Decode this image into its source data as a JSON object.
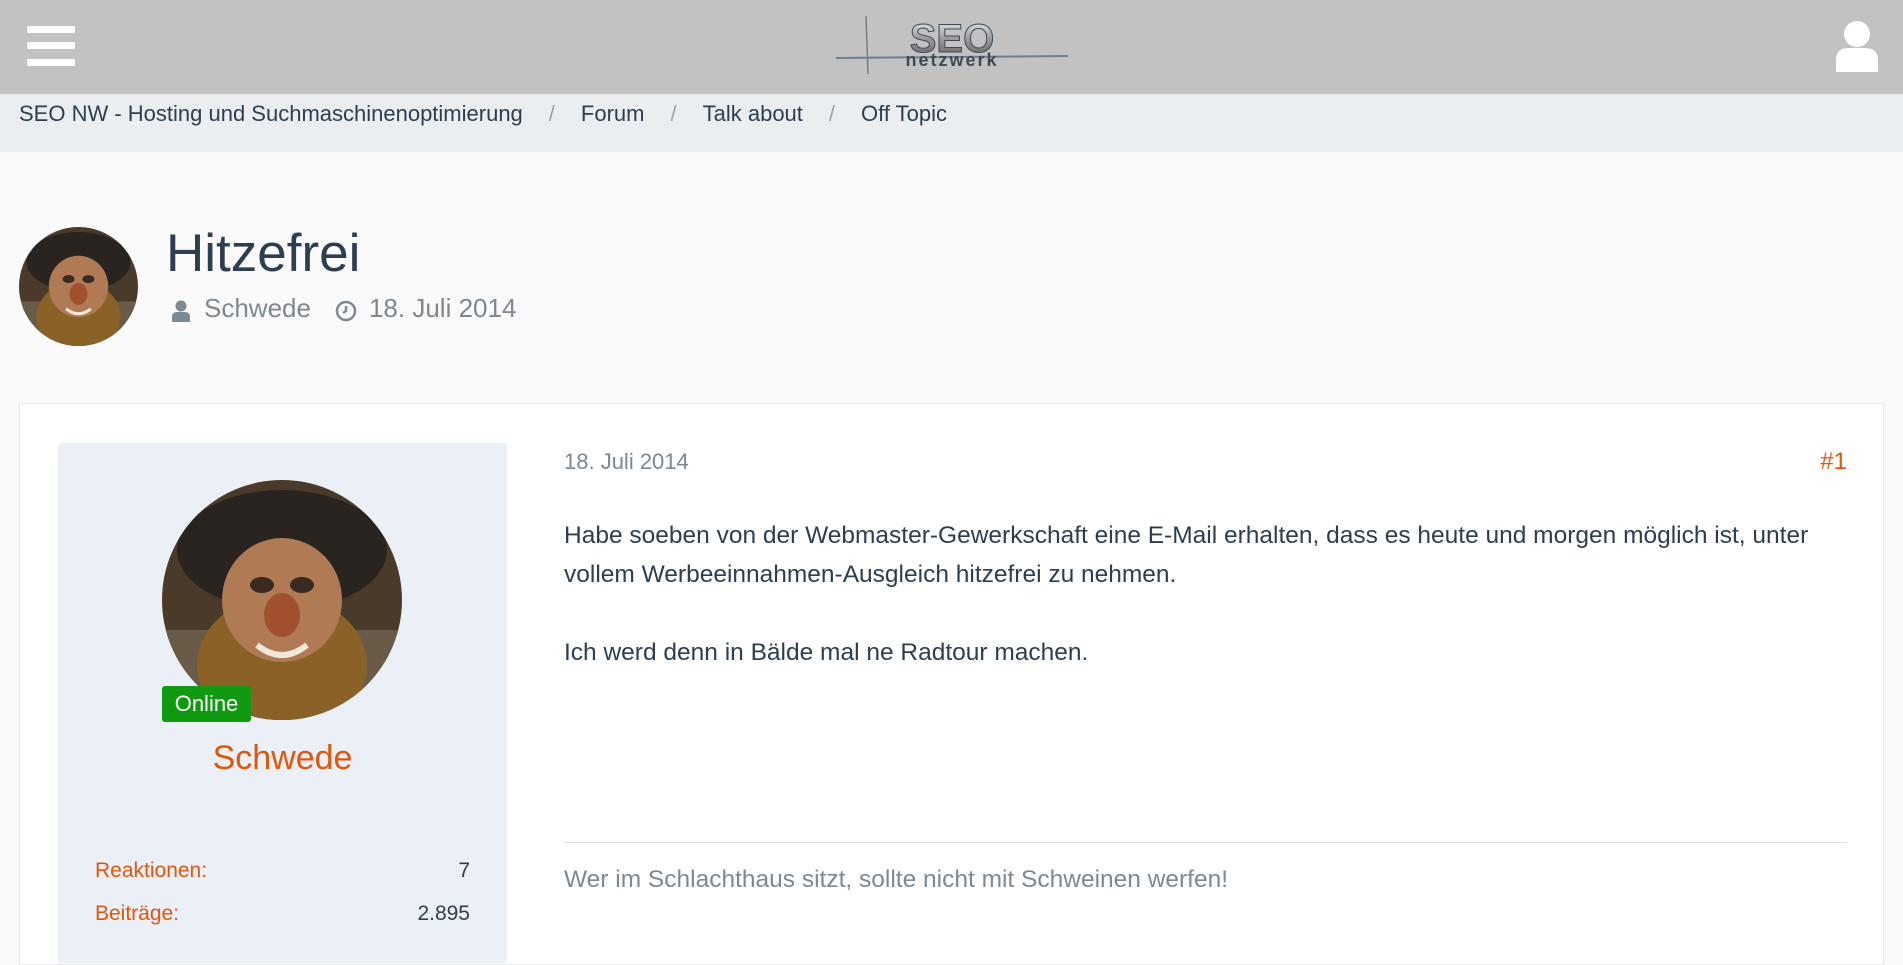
{
  "header": {
    "menu_icon": "hamburger-icon",
    "logo_text": "SEO",
    "logo_subtext": "netzwerk",
    "user_icon": "user-icon",
    "background": "#c2c2c2"
  },
  "breadcrumb": {
    "items": [
      {
        "label": "SEO NW - Hosting und Suchmaschinenoptimierung"
      },
      {
        "label": "Forum"
      },
      {
        "label": "Talk about"
      },
      {
        "label": "Off Topic"
      }
    ],
    "separator": "/"
  },
  "thread": {
    "title": "Hitzefrei",
    "author": "Schwede",
    "date": "18. Juli 2014",
    "author_icon": "user-icon",
    "date_icon": "clock-icon"
  },
  "post": {
    "date": "18. Juli 2014",
    "number": "#1",
    "body": [
      "Habe soeben von der Webmaster-Gewerkschaft eine E-Mail erhalten, dass es heute und morgen möglich ist, unter vollem Werbeeinnahmen-Ausgleich hitzefrei zu nehmen.",
      "Ich werd denn in Bälde mal ne Radtour machen."
    ],
    "signature": "Wer im Schlachthaus sitzt, sollte nicht mit Schweinen werfen!",
    "author": {
      "name": "Schwede",
      "status": "Online",
      "stats": [
        {
          "label": "Reaktionen:",
          "value": "7"
        },
        {
          "label": "Beiträge:",
          "value": "2.895"
        }
      ]
    }
  },
  "colors": {
    "accent": "#e2560c",
    "online": "#119a11",
    "text": "#2c3e50",
    "muted": "#7d8891"
  }
}
